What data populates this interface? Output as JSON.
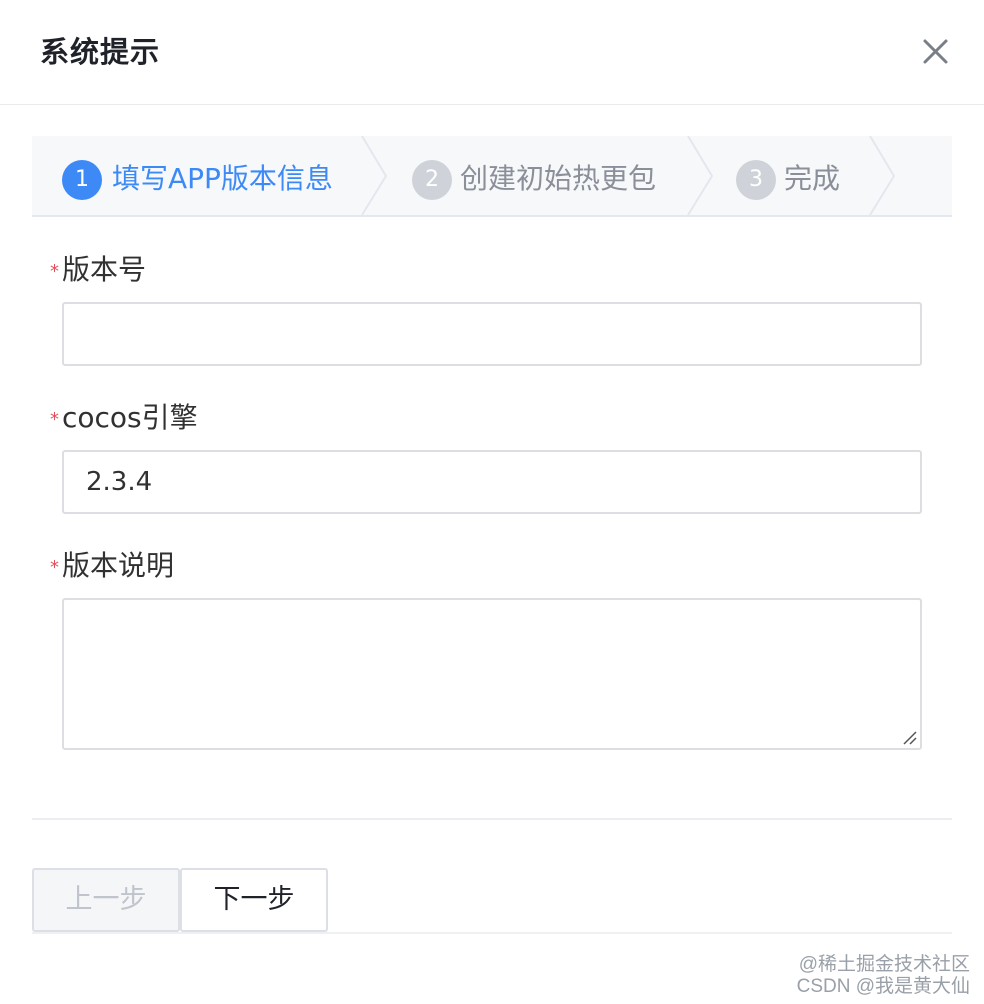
{
  "dialog": {
    "title": "系统提示",
    "close_glyph": "✕"
  },
  "steps": [
    {
      "number": "1",
      "label": "填写APP版本信息",
      "state": "active"
    },
    {
      "number": "2",
      "label": "创建初始热更包",
      "state": "inactive"
    },
    {
      "number": "3",
      "label": "完成",
      "state": "inactive"
    }
  ],
  "form": {
    "required_mark": "*",
    "version_number": {
      "label": "版本号",
      "value": ""
    },
    "engine": {
      "label": "cocos引擎",
      "value": "2.3.4"
    },
    "description": {
      "label": "版本说明",
      "value": ""
    }
  },
  "buttons": {
    "prev_label": "上一步",
    "next_label": "下一步"
  },
  "watermark": {
    "line1": "@稀土掘金技术社区",
    "line2": "CSDN @我是黄大仙"
  },
  "colors": {
    "accent": "#3d8af7",
    "required": "#e34d59",
    "inactive_step": "#cfd3d9"
  }
}
